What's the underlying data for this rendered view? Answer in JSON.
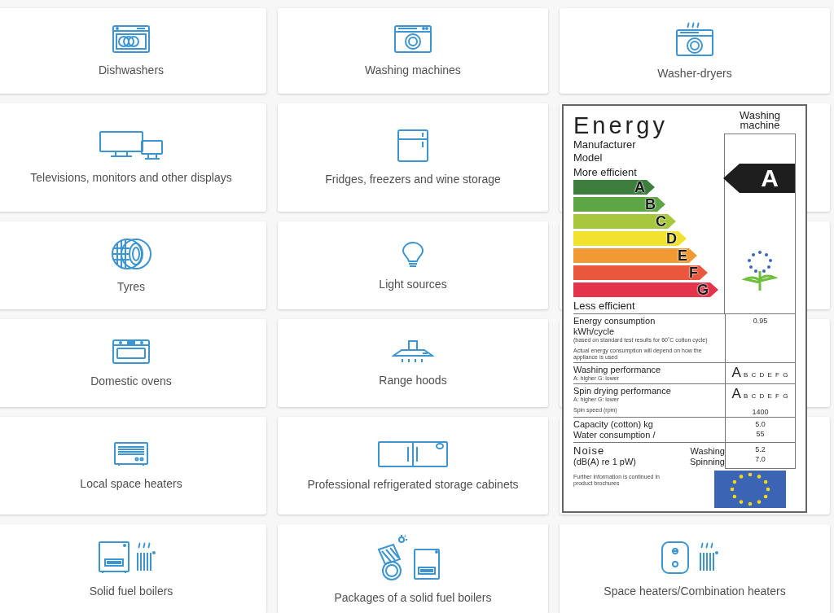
{
  "cards": [
    {
      "title": "Dishwashers"
    },
    {
      "title": "Washing machines"
    },
    {
      "title": "Washer-dryers"
    },
    {
      "title": "Televisions, monitors and other displays"
    },
    {
      "title": "Fridges, freezers and wine storage"
    },
    {
      "title": "Tyres"
    },
    {
      "title": "Light sources"
    },
    {
      "title": "Domestic ovens"
    },
    {
      "title": "Range hoods"
    },
    {
      "title": "Local space heaters"
    },
    {
      "title": "Professional refrigerated storage cabinets"
    },
    {
      "title": "Solid fuel boilers"
    },
    {
      "title": "Packages of a solid fuel boilers"
    },
    {
      "title": "Space heaters/Combination heaters"
    }
  ],
  "energy_label": {
    "title": "Energy",
    "appliance": "Washing machine",
    "manufacturer": "Manufacturer",
    "model": "Model",
    "more_efficient": "More efficient",
    "less_efficient": "Less efficient",
    "rating": "A",
    "classes": [
      {
        "letter": "A",
        "color": "#3e7e3c"
      },
      {
        "letter": "B",
        "color": "#5ca646"
      },
      {
        "letter": "C",
        "color": "#a7c83c"
      },
      {
        "letter": "D",
        "color": "#f1e22f"
      },
      {
        "letter": "E",
        "color": "#f19a34"
      },
      {
        "letter": "F",
        "color": "#e9573c"
      },
      {
        "letter": "G",
        "color": "#e2344b"
      }
    ],
    "energy_consumption": {
      "label": "Energy consumption",
      "unit": "kWh/cycle",
      "note": "(based on standard test results for 60˚C cotton cycle)",
      "remark": "Actual energy consumption will depend on how the appliance is used",
      "value": "0.95"
    },
    "washing_performance": {
      "label": "Washing performance",
      "note": "A: higher  G: lower",
      "grade": "A",
      "scale": "B C D E F G"
    },
    "spin_drying": {
      "label": "Spin drying performance",
      "note": "A: higher  G: lower",
      "grade": "A",
      "scale": "B C D E F G",
      "speed_label": "Spin speed (rpm)",
      "speed": "1400"
    },
    "capacity": {
      "label": "Capacity (cotton) kg",
      "value": "5.0"
    },
    "water": {
      "label": "Water consumption /",
      "value": "55"
    },
    "noise": {
      "label": "Noise",
      "unit": "(dB(A) re 1 pW)",
      "washing_label": "Washing",
      "washing": "5.2",
      "spinning_label": "Spinning",
      "spinning": "7.0"
    },
    "footer": "Further information is continued in product brochures"
  }
}
